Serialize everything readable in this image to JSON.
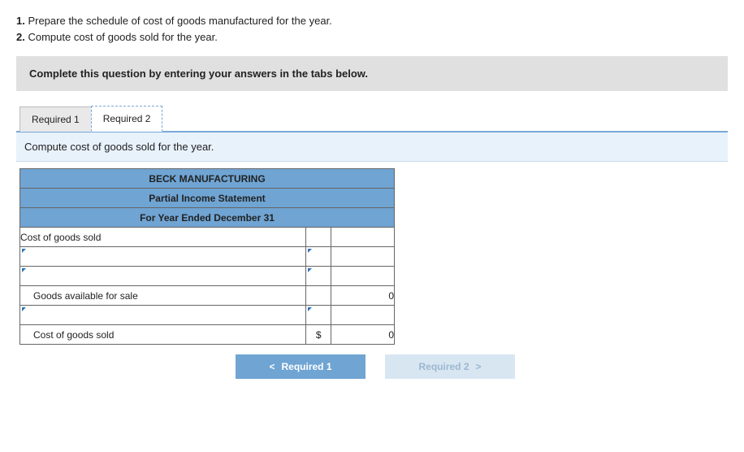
{
  "instructions": {
    "item1_num": "1.",
    "item1_text": " Prepare the schedule of cost of goods manufactured for the year.",
    "item2_num": "2.",
    "item2_text": " Compute cost of goods sold for the year."
  },
  "banner": "Complete this question by entering your answers in the tabs below.",
  "tabs": {
    "tab1": "Required 1",
    "tab2": "Required 2"
  },
  "tab_prompt": "Compute cost of goods sold for the year.",
  "sheet": {
    "h1": "BECK MANUFACTURING",
    "h2": "Partial Income Statement",
    "h3": "For Year Ended December 31",
    "row_cogs_label": "Cost of goods sold",
    "row_gas_label": "Goods available for sale",
    "row_gas_val": "0",
    "row_final_label": "Cost of goods sold",
    "row_final_sym": "$",
    "row_final_val": "0"
  },
  "nav": {
    "prev_chev": "<",
    "prev": "Required 1",
    "next": "Required 2",
    "next_chev": ">"
  }
}
